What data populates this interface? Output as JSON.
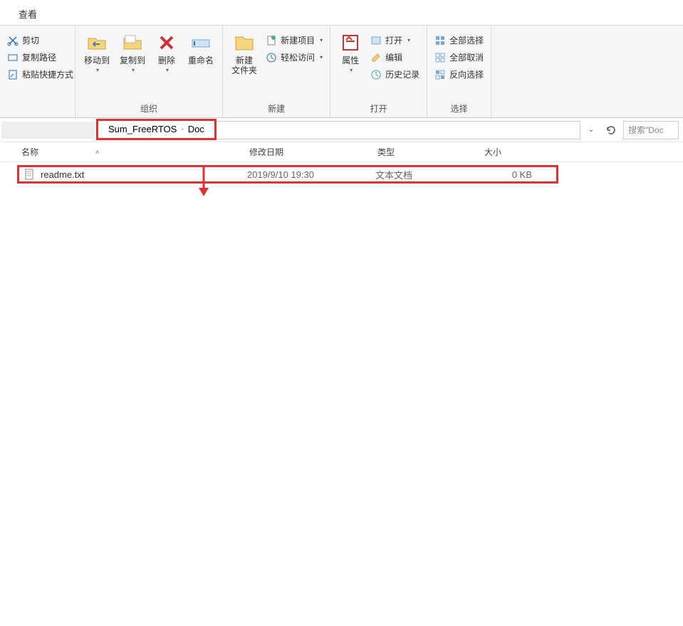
{
  "tabs": {
    "active": "查看"
  },
  "ribbon": {
    "clipboard": {
      "cut": "剪切",
      "copy_path": "复制路径",
      "paste_shortcut": "粘贴快捷方式"
    },
    "organize": {
      "move_to": "移动到",
      "copy_to": "复制到",
      "delete": "删除",
      "rename": "重命名",
      "label": "组织"
    },
    "new": {
      "new_folder": "新建\n文件夹",
      "new_item": "新建项目",
      "easy_access": "轻松访问",
      "label": "新建"
    },
    "open": {
      "properties": "属性",
      "open": "打开",
      "edit": "编辑",
      "history": "历史记录",
      "label": "打开"
    },
    "select": {
      "select_all": "全部选择",
      "select_none": "全部取消",
      "invert": "反向选择",
      "label": "选择"
    }
  },
  "breadcrumb": {
    "seg1": "Sum_FreeRTOS",
    "seg2": "Doc"
  },
  "search": {
    "placeholder": "搜索\"Doc"
  },
  "columns": {
    "name": "名称",
    "date": "修改日期",
    "type": "类型",
    "size": "大小"
  },
  "files": [
    {
      "name": "readme.txt",
      "date": "2019/9/10 19:30",
      "type": "文本文档",
      "size": "0 KB"
    }
  ]
}
